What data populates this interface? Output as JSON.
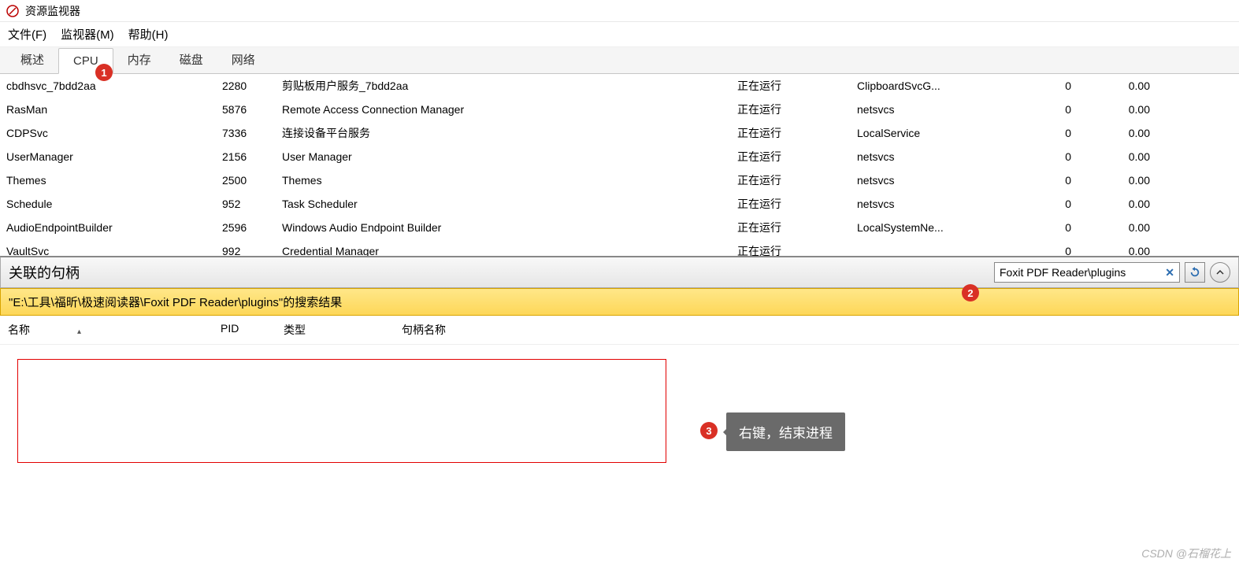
{
  "window": {
    "title": "资源监视器"
  },
  "menus": {
    "file": "文件(F)",
    "monitor": "监视器(M)",
    "help": "帮助(H)"
  },
  "tabs": {
    "overview": "概述",
    "cpu": "CPU",
    "memory": "内存",
    "disk": "磁盘",
    "network": "网络"
  },
  "processes": [
    {
      "name": "cbdhsvc_7bdd2aa",
      "pid": "2280",
      "desc": "剪贴板用户服务_7bdd2aa",
      "status": "正在运行",
      "group": "ClipboardSvcG...",
      "threads": "0",
      "cpu": "0.00"
    },
    {
      "name": "RasMan",
      "pid": "5876",
      "desc": "Remote Access Connection Manager",
      "status": "正在运行",
      "group": "netsvcs",
      "threads": "0",
      "cpu": "0.00"
    },
    {
      "name": "CDPSvc",
      "pid": "7336",
      "desc": "连接设备平台服务",
      "status": "正在运行",
      "group": "LocalService",
      "threads": "0",
      "cpu": "0.00"
    },
    {
      "name": "UserManager",
      "pid": "2156",
      "desc": "User Manager",
      "status": "正在运行",
      "group": "netsvcs",
      "threads": "0",
      "cpu": "0.00"
    },
    {
      "name": "Themes",
      "pid": "2500",
      "desc": "Themes",
      "status": "正在运行",
      "group": "netsvcs",
      "threads": "0",
      "cpu": "0.00"
    },
    {
      "name": "Schedule",
      "pid": "952",
      "desc": "Task Scheduler",
      "status": "正在运行",
      "group": "netsvcs",
      "threads": "0",
      "cpu": "0.00"
    },
    {
      "name": "AudioEndpointBuilder",
      "pid": "2596",
      "desc": "Windows Audio Endpoint Builder",
      "status": "正在运行",
      "group": "LocalSystemNe...",
      "threads": "0",
      "cpu": "0.00"
    },
    {
      "name": "VaultSvc",
      "pid": "992",
      "desc": "Credential Manager",
      "status": "正在运行",
      "group": "",
      "threads": "0",
      "cpu": "0.00"
    }
  ],
  "handles": {
    "title": "关联的句柄",
    "search_value": "Foxit PDF Reader\\plugins",
    "banner": "\"E:\\工具\\福昕\\极速阅读器\\Foxit PDF Reader\\plugins\"的搜索结果",
    "cols": {
      "name": "名称",
      "pid": "PID",
      "type": "类型",
      "hname": "句柄名称"
    }
  },
  "annotations": {
    "b1": "1",
    "b2": "2",
    "b3": "3",
    "tooltip": "右键，结束进程"
  },
  "watermark": "CSDN @石榴花上"
}
